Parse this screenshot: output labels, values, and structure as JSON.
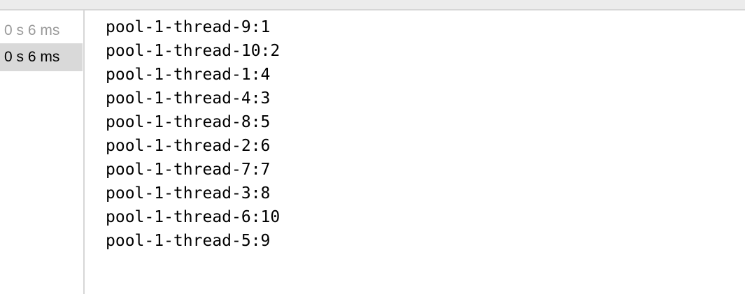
{
  "tests": [
    {
      "duration": "0 s 6 ms",
      "selected": false
    },
    {
      "duration": "0 s 6 ms",
      "selected": true
    }
  ],
  "console": {
    "lines": [
      "pool-1-thread-9:1",
      "pool-1-thread-10:2",
      "pool-1-thread-1:4",
      "pool-1-thread-4:3",
      "pool-1-thread-8:5",
      "pool-1-thread-2:6",
      "pool-1-thread-7:7",
      "pool-1-thread-3:8",
      "pool-1-thread-6:10",
      "pool-1-thread-5:9"
    ]
  }
}
